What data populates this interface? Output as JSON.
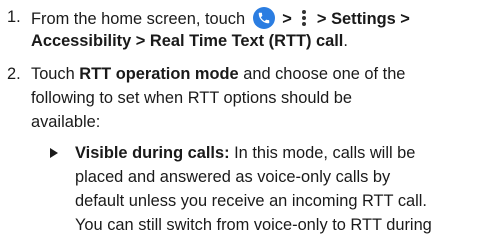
{
  "steps": [
    {
      "number": "1.",
      "line1_prefix": "From the home screen, touch",
      "sep1": ">",
      "sep2": ">",
      "settings": "Settings",
      "sep3": ">",
      "accessibility": "Accessibility",
      "sep4": ">",
      "rtt_call": "Real Time Text (RTT) call",
      "end": ".",
      "icons": [
        "phone-icon",
        "more-options-icon"
      ]
    },
    {
      "number": "2.",
      "touch": "Touch ",
      "rtt_mode": "RTT operation mode",
      "line1_rest": " and choose one of the",
      "line2": "following to set when RTT options should be",
      "line3": "available:"
    }
  ],
  "bullet": {
    "icon": "triangle-bullet-icon",
    "title": "Visible during calls:",
    "line1_rest": " In this mode, calls will be",
    "line2": "placed and answered as voice-only calls by",
    "line3": "default unless you receive an incoming RTT call.",
    "line4": "You can still switch from voice-only to RTT during"
  },
  "colors": {
    "text": "#1a1a1a",
    "phone_icon_bg": "#2b7de1"
  }
}
